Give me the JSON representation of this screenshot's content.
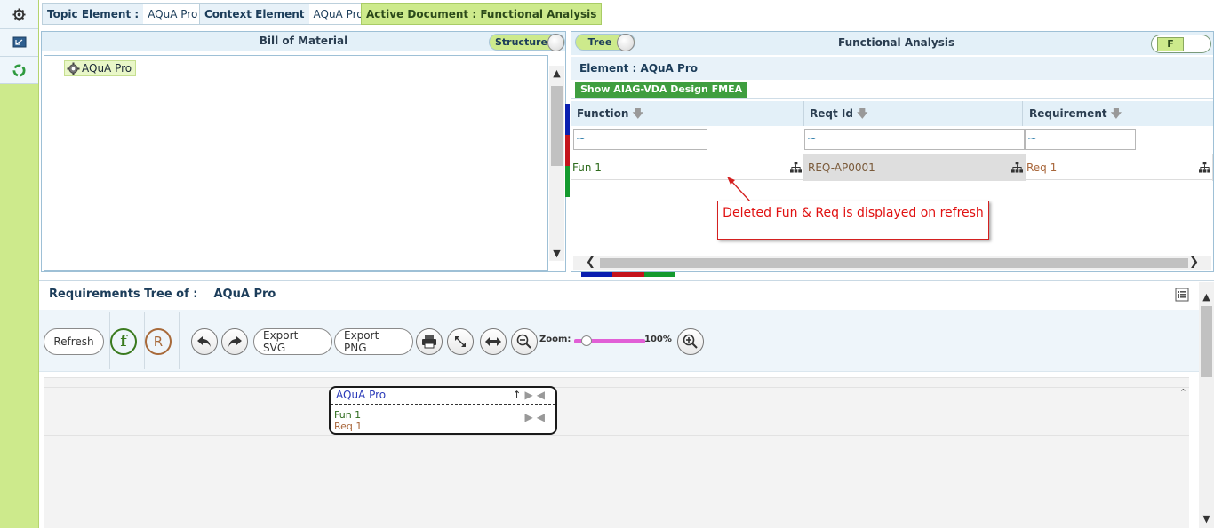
{
  "rail": {
    "icons": [
      "gear-icon",
      "monitor-icon",
      "recycle-icon"
    ]
  },
  "topbar": {
    "topic_label": "Topic Element :",
    "topic_value": "AQuA Pro",
    "context_label": "Context Element",
    "context_value": "AQuA Pro",
    "active_document": "Active Document : Functional Analysis"
  },
  "bom": {
    "title": "Bill of Material",
    "toggle_label": "Structure",
    "tree": [
      {
        "label": "AQuA Pro",
        "icon": "gear-icon"
      }
    ]
  },
  "fa": {
    "title": "Functional Analysis",
    "tree_toggle": "Tree",
    "mode_toggle": "F",
    "element_label": "Element : AQuA Pro",
    "fmea_button": "Show AIAG-VDA Design FMEA",
    "columns": [
      "Function",
      "Reqt Id",
      "Requirement"
    ],
    "filters": [
      "~",
      "~",
      "~"
    ],
    "rows": [
      {
        "function": "Fun 1",
        "reqt_id": "REQ-AP0001",
        "requirement": "Req 1"
      }
    ],
    "colors": {
      "function": "#2e6b1d",
      "reqt_id": "#7a5a3a",
      "requirement": "#a8663a"
    }
  },
  "annotation": {
    "text": "Deleted Fun & Req is displayed on refresh"
  },
  "req_tree": {
    "title": "Requirements Tree of :",
    "element": "AQuA Pro",
    "toolbar": {
      "refresh": "Refresh",
      "function_letter": "f",
      "requirement_letter": "R",
      "export_svg": "Export SVG",
      "export_png": "Export PNG",
      "zoom_label": "Zoom:",
      "zoom_value": "100%"
    },
    "node": {
      "title": "AQuA Pro",
      "function": "Fun 1",
      "requirement": "Req 1"
    }
  }
}
